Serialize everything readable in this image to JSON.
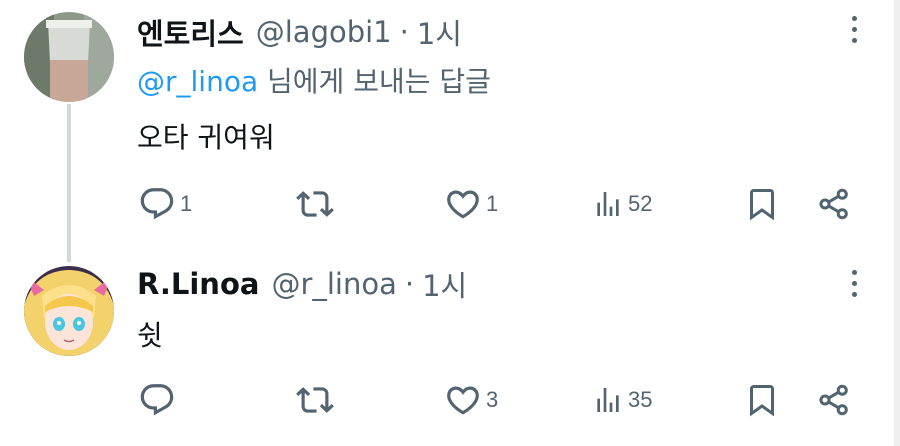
{
  "tweets": [
    {
      "display_name": "엔토리스",
      "handle": "@lagobi1",
      "separator": "·",
      "time": "1시",
      "reply_prefix": "@r_linoa",
      "reply_suffix": " 님에게 보내는 답글",
      "text": "오타 귀여워",
      "replies": "1",
      "retweets": "",
      "likes": "1",
      "views": "52",
      "icons": [
        "reply-icon",
        "retweet-icon",
        "like-icon",
        "views-icon",
        "bookmark-icon",
        "share-icon",
        "more-icon"
      ]
    },
    {
      "display_name": "R.Linoa",
      "handle": "@r_linoa",
      "separator": "·",
      "time": "1시",
      "text": "쉿",
      "replies": "",
      "retweets": "",
      "likes": "3",
      "views": "35",
      "icons": [
        "reply-icon",
        "retweet-icon",
        "like-icon",
        "views-icon",
        "bookmark-icon",
        "share-icon",
        "more-icon"
      ]
    }
  ],
  "colors": {
    "text": "#0f1419",
    "secondary": "#536471",
    "link": "#1d9bf0",
    "thread_line": "#cfd9de"
  }
}
